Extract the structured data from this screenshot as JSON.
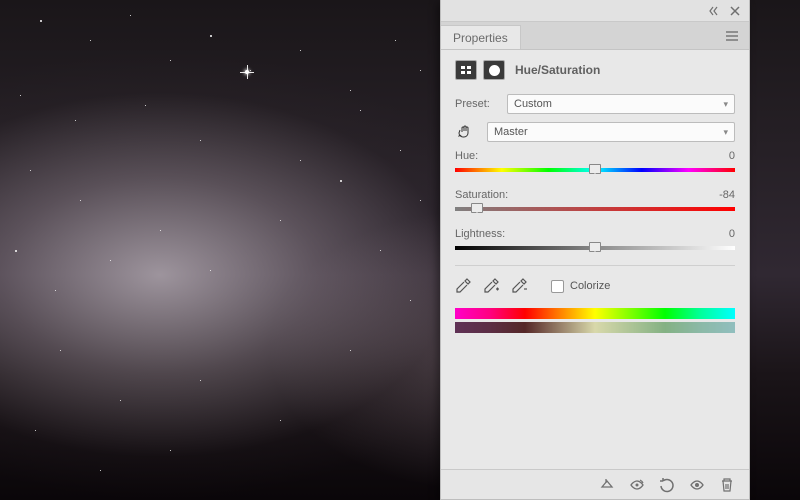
{
  "panel": {
    "tab": "Properties",
    "title": "Hue/Saturation",
    "preset_label": "Preset:",
    "preset_value": "Custom",
    "channel_value": "Master",
    "hue": {
      "label": "Hue:",
      "value": "0",
      "pos": 50
    },
    "saturation": {
      "label": "Saturation:",
      "value": "-84",
      "pos": 8
    },
    "lightness": {
      "label": "Lightness:",
      "value": "0",
      "pos": 50
    },
    "colorize_label": "Colorize"
  }
}
